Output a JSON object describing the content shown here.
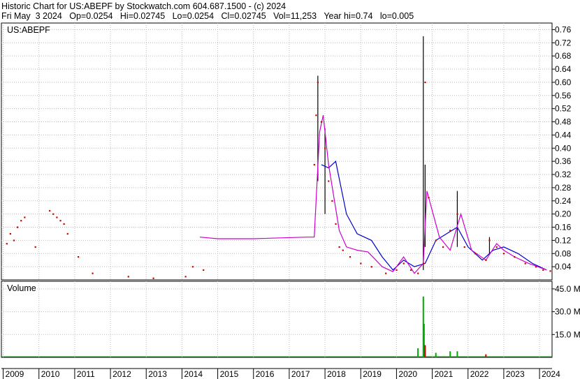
{
  "header": {
    "line1": "Historic Chart for US:ABEPF by Stockwatch.com 604.687.1500 - (c) 2024",
    "line2": "Fri May  3 2024   Op=0.0254   Hi=0.02745   Lo=0.0254   Cl=0.02745   Vol=11,253   Year hi=0.74   lo=0.005"
  },
  "chart_data": [
    {
      "type": "line",
      "panel": "price",
      "label": "US:ABEPF",
      "ylim": [
        0,
        0.78
      ],
      "y_ticks": [
        "0.76",
        "0.72",
        "0.68",
        "0.64",
        "0.60",
        "0.56",
        "0.52",
        "0.48",
        "0.44",
        "0.40",
        "0.36",
        "0.32",
        "0.28",
        "0.24",
        "0.20",
        "0.16",
        "0.12",
        "0.08",
        "0.04"
      ],
      "x_ticks": [
        "2009",
        "2010",
        "2011",
        "2012",
        "2013",
        "2014",
        "2015",
        "2016",
        "2017",
        "2018",
        "2019",
        "2020",
        "2021",
        "2022",
        "2023",
        "2024"
      ],
      "grid": true,
      "colors": {
        "price_bar": "#000000",
        "close_dot": "#cc0000",
        "ma_short": "#cc00cc",
        "ma_long": "#0000cc"
      },
      "close_points": [
        [
          2009.1,
          0.11
        ],
        [
          2009.2,
          0.14
        ],
        [
          2009.3,
          0.12
        ],
        [
          2009.4,
          0.16
        ],
        [
          2009.5,
          0.18
        ],
        [
          2009.6,
          0.19
        ],
        [
          2009.9,
          0.1
        ],
        [
          2010.3,
          0.21
        ],
        [
          2010.4,
          0.2
        ],
        [
          2010.5,
          0.19
        ],
        [
          2010.6,
          0.18
        ],
        [
          2010.7,
          0.17
        ],
        [
          2010.8,
          0.14
        ],
        [
          2011.1,
          0.07
        ],
        [
          2011.5,
          0.02
        ],
        [
          2012.5,
          0.01
        ],
        [
          2013.2,
          0.005
        ],
        [
          2014.1,
          0.01
        ],
        [
          2014.3,
          0.04
        ],
        [
          2014.6,
          0.03
        ],
        [
          2017.7,
          0.35
        ],
        [
          2017.75,
          0.5
        ],
        [
          2017.8,
          0.6
        ],
        [
          2017.9,
          0.48
        ],
        [
          2018.0,
          0.4
        ],
        [
          2018.1,
          0.3
        ],
        [
          2018.2,
          0.24
        ],
        [
          2018.3,
          0.17
        ],
        [
          2018.4,
          0.1
        ],
        [
          2018.5,
          0.09
        ],
        [
          2018.7,
          0.07
        ],
        [
          2019.0,
          0.05
        ],
        [
          2019.3,
          0.04
        ],
        [
          2019.7,
          0.02
        ],
        [
          2020.0,
          0.03
        ],
        [
          2020.2,
          0.05
        ],
        [
          2020.4,
          0.03
        ],
        [
          2020.6,
          0.02
        ],
        [
          2020.75,
          0.05
        ],
        [
          2020.8,
          0.6
        ],
        [
          2020.9,
          0.25
        ],
        [
          2021.1,
          0.12
        ],
        [
          2021.3,
          0.1
        ],
        [
          2021.5,
          0.15
        ],
        [
          2021.7,
          0.2
        ],
        [
          2021.9,
          0.1
        ],
        [
          2022.2,
          0.08
        ],
        [
          2022.5,
          0.06
        ],
        [
          2022.6,
          0.12
        ],
        [
          2022.8,
          0.1
        ],
        [
          2023.0,
          0.08
        ],
        [
          2023.3,
          0.07
        ],
        [
          2023.6,
          0.05
        ],
        [
          2023.9,
          0.04
        ],
        [
          2024.1,
          0.03
        ],
        [
          2024.3,
          0.027
        ]
      ],
      "price_spikes": [
        [
          2017.8,
          0.3,
          0.62
        ],
        [
          2018.0,
          0.2,
          0.46
        ],
        [
          2020.75,
          0.03,
          0.74
        ],
        [
          2020.8,
          0.1,
          0.35
        ],
        [
          2021.7,
          0.1,
          0.27
        ],
        [
          2022.6,
          0.08,
          0.13
        ]
      ],
      "ma_short": [
        [
          2014.5,
          0.13
        ],
        [
          2015.0,
          0.125
        ],
        [
          2016.0,
          0.125
        ],
        [
          2017.5,
          0.13
        ],
        [
          2017.7,
          0.13
        ],
        [
          2017.85,
          0.45
        ],
        [
          2017.95,
          0.5
        ],
        [
          2018.1,
          0.35
        ],
        [
          2018.4,
          0.15
        ],
        [
          2018.6,
          0.1
        ],
        [
          2018.9,
          0.09
        ],
        [
          2019.2,
          0.085
        ],
        [
          2019.6,
          0.04
        ],
        [
          2019.9,
          0.025
        ],
        [
          2020.2,
          0.07
        ],
        [
          2020.5,
          0.02
        ],
        [
          2020.75,
          0.05
        ],
        [
          2020.85,
          0.27
        ],
        [
          2021.2,
          0.13
        ],
        [
          2021.5,
          0.09
        ],
        [
          2021.8,
          0.2
        ],
        [
          2022.1,
          0.09
        ],
        [
          2022.5,
          0.06
        ],
        [
          2022.8,
          0.11
        ],
        [
          2023.0,
          0.09
        ],
        [
          2023.3,
          0.07
        ],
        [
          2023.7,
          0.05
        ],
        [
          2024.2,
          0.03
        ]
      ],
      "ma_long": [
        [
          2017.9,
          0.35
        ],
        [
          2018.1,
          0.34
        ],
        [
          2018.3,
          0.36
        ],
        [
          2018.6,
          0.2
        ],
        [
          2018.9,
          0.14
        ],
        [
          2019.3,
          0.12
        ],
        [
          2019.6,
          0.07
        ],
        [
          2019.9,
          0.03
        ],
        [
          2020.2,
          0.06
        ],
        [
          2020.5,
          0.04
        ],
        [
          2020.8,
          0.05
        ],
        [
          2021.1,
          0.12
        ],
        [
          2021.4,
          0.14
        ],
        [
          2021.7,
          0.16
        ],
        [
          2022.0,
          0.1
        ],
        [
          2022.4,
          0.06
        ],
        [
          2022.7,
          0.09
        ],
        [
          2023.0,
          0.1
        ],
        [
          2023.4,
          0.08
        ],
        [
          2023.8,
          0.05
        ],
        [
          2024.2,
          0.03
        ]
      ]
    },
    {
      "type": "bar",
      "panel": "volume",
      "label": "Volume",
      "ylim": [
        0,
        50
      ],
      "y_ticks": [
        "45.0 M",
        "30.0 M",
        "15.0 M"
      ],
      "colors": {
        "up": "#00aa00",
        "down": "#cc0000"
      },
      "bars": [
        [
          2020.75,
          40,
          "up"
        ],
        [
          2020.77,
          22,
          "up"
        ],
        [
          2020.8,
          8,
          "down"
        ],
        [
          2020.6,
          6,
          "up"
        ],
        [
          2021.1,
          3,
          "up"
        ],
        [
          2021.5,
          4,
          "up"
        ],
        [
          2021.7,
          4,
          "up"
        ],
        [
          2022.5,
          2,
          "down"
        ]
      ]
    }
  ]
}
